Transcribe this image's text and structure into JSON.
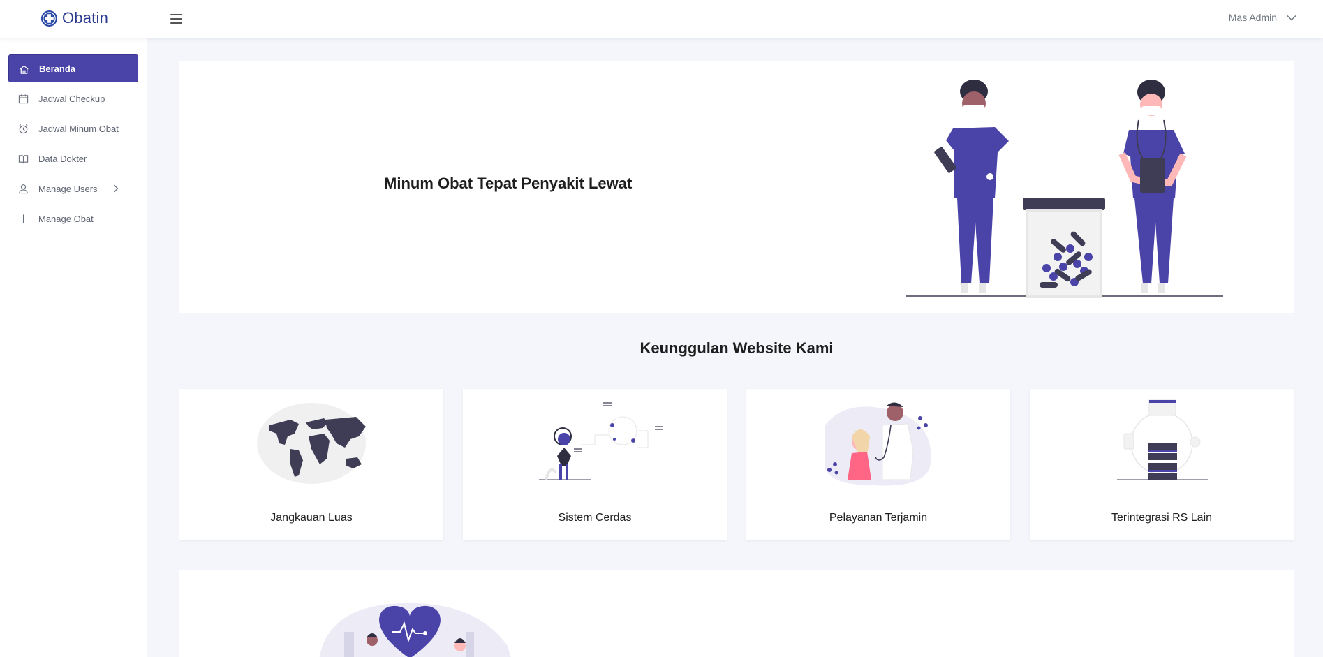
{
  "app": {
    "name": "Obatin"
  },
  "user": {
    "name": "Mas Admin"
  },
  "sidebar": {
    "items": [
      {
        "label": "Beranda",
        "icon": "home-icon",
        "active": true
      },
      {
        "label": "Jadwal Checkup",
        "icon": "calendar-icon",
        "active": false
      },
      {
        "label": "Jadwal Minum Obat",
        "icon": "alarm-clock-icon",
        "active": false
      },
      {
        "label": "Data Dokter",
        "icon": "book-icon",
        "active": false
      },
      {
        "label": "Manage Users",
        "icon": "user-icon",
        "active": false,
        "has_submenu": true
      },
      {
        "label": "Manage Obat",
        "icon": "plus-icon",
        "active": false
      }
    ]
  },
  "hero": {
    "title": "Minum Obat Tepat Penyakit Lewat",
    "illustration": "doctors-with-pill-jar-illustration"
  },
  "features": {
    "title": "Keunggulan Website Kami",
    "cards": [
      {
        "label": "Jangkauan Luas",
        "illustration": "world-map-illustration"
      },
      {
        "label": "Sistem Cerdas",
        "illustration": "smart-system-illustration"
      },
      {
        "label": "Pelayanan Terjamin",
        "illustration": "doctor-patient-illustration"
      },
      {
        "label": "Terintegrasi RS Lain",
        "illustration": "server-network-illustration"
      }
    ]
  },
  "colors": {
    "primary": "#4b44a8",
    "brand": "#2b3a8f",
    "background": "#f4f6fb",
    "dark": "#3f3d56"
  }
}
